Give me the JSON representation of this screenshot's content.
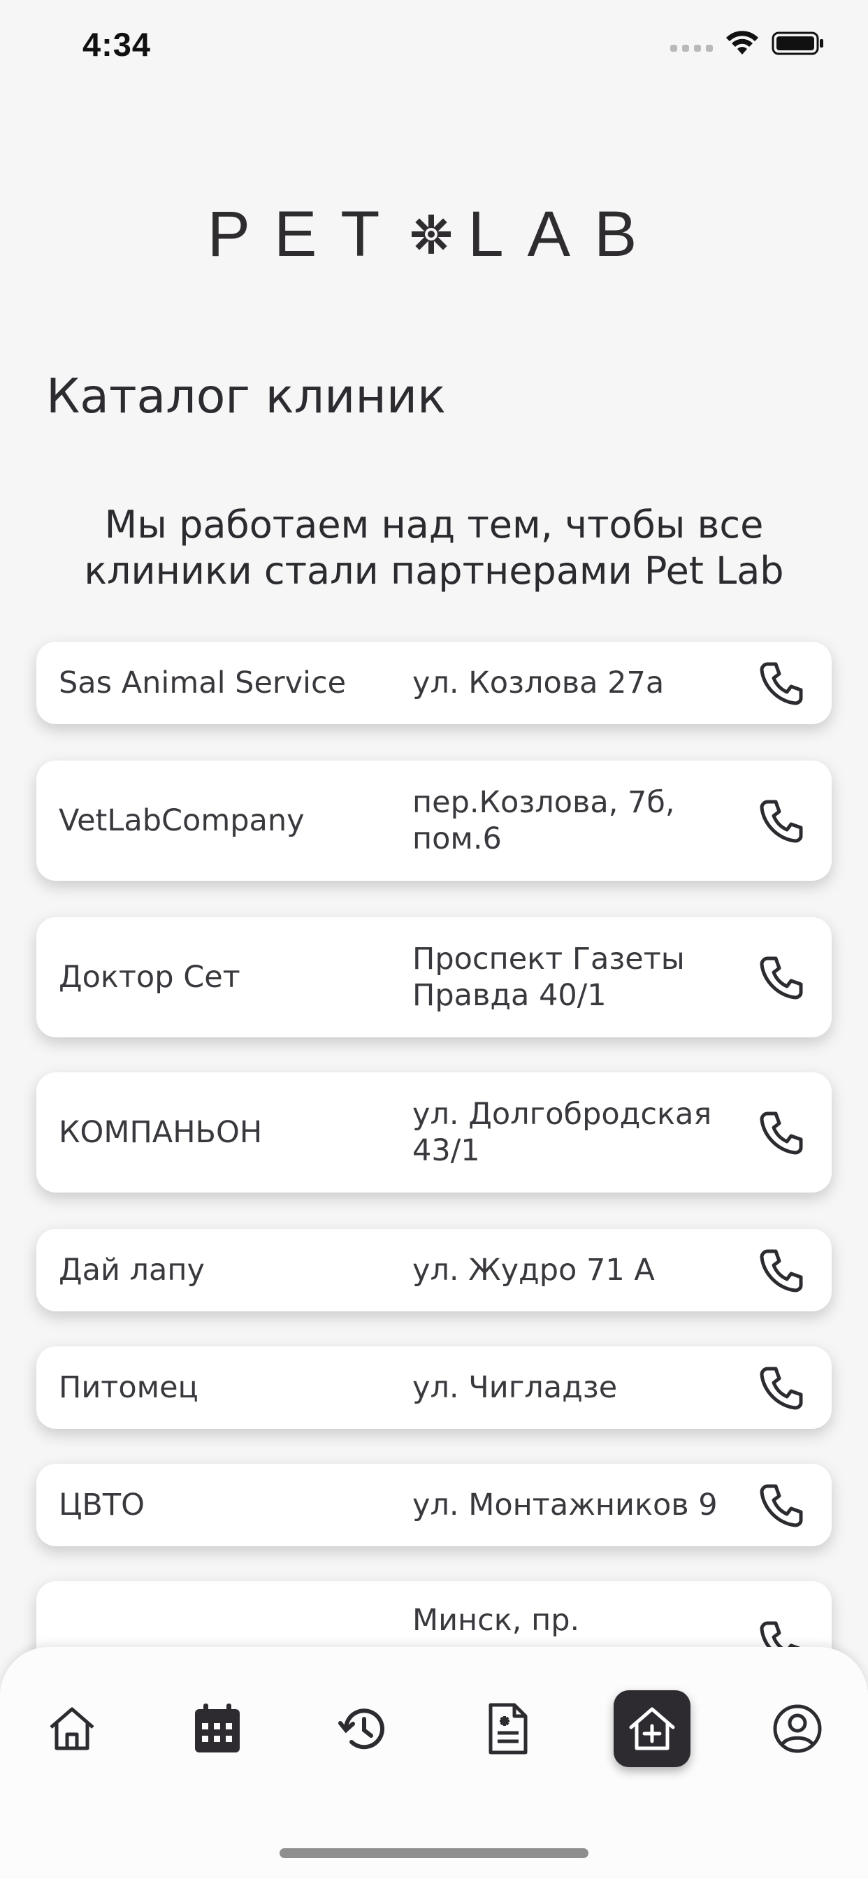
{
  "status_bar": {
    "time": "4:34"
  },
  "logo": {
    "left": "PET",
    "right": "LAB"
  },
  "page_title": "Каталог клиник",
  "subtitle": "Мы работаем над тем, чтобы все клиники стали партнерами Pet Lab",
  "clinics": [
    {
      "name": "Sas Animal Service",
      "address": "ул. Козлова 27а",
      "icon": "phone-icon"
    },
    {
      "name": "VetLabCompany",
      "address": "пер.Козлова, 7б, пом.6",
      "icon": "phone-icon"
    },
    {
      "name": "Доктор Сет",
      "address": "Проспект Газеты Правда 40/1",
      "icon": "phone-icon"
    },
    {
      "name": "КОМПАНЬОН",
      "address": "ул. Долгобродская 43/1",
      "icon": "phone-icon"
    },
    {
      "name": "Дай лапу",
      "address": "ул. Жудро 71 А",
      "icon": "phone-icon"
    },
    {
      "name": "Питомец",
      "address": "ул. Чигладзе",
      "icon": "phone-icon"
    },
    {
      "name": "ЦВТО",
      "address": "ул. Монтажников 9",
      "icon": "phone-icon"
    },
    {
      "name": "",
      "address": "Минск, пр.",
      "icon": "phone-icon"
    }
  ],
  "tabs": [
    {
      "icon": "home-icon",
      "active": false
    },
    {
      "icon": "calendar-icon",
      "active": false
    },
    {
      "icon": "history-icon",
      "active": false
    },
    {
      "icon": "medical-document-icon",
      "active": false
    },
    {
      "icon": "clinic-icon",
      "active": true
    },
    {
      "icon": "profile-icon",
      "active": false
    }
  ],
  "colors": {
    "background": "#f6f6f6",
    "text": "#2b2a2e",
    "active_tab": "#2d2b2f"
  }
}
